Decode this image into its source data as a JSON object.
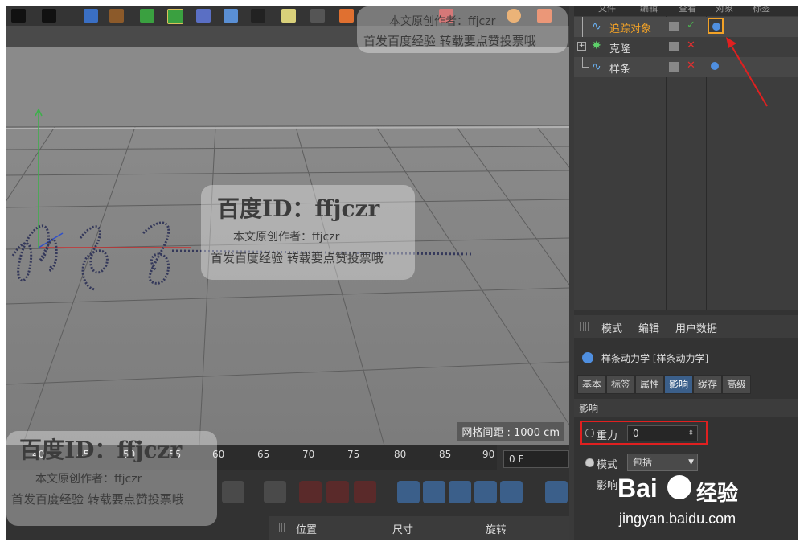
{
  "object_manager": {
    "menu": [
      "文件",
      "编辑",
      "查看",
      "对象",
      "标签"
    ],
    "objects": [
      {
        "name": "追踪对象",
        "highlighted": true
      },
      {
        "name": "克隆",
        "highlighted": false
      },
      {
        "name": "样条",
        "highlighted": false
      }
    ]
  },
  "attributes": {
    "menu": [
      "模式",
      "编辑",
      "用户数据"
    ],
    "title": "样条动力学 [样条动力学]",
    "tabs": [
      "基本",
      "标签",
      "属性",
      "影响",
      "缓存",
      "高级"
    ],
    "active_tab": "影响",
    "section": "影响",
    "gravity_label": "重力",
    "gravity_value": "0",
    "mode_label": "模式",
    "mode_value": "包括",
    "influence_label": "影响"
  },
  "viewport": {
    "grid_info": "网格间距 : 1000 cm"
  },
  "timeline": {
    "ticks": [
      "40",
      "45",
      "50",
      "55",
      "60",
      "65",
      "70",
      "75",
      "80",
      "85",
      "90"
    ],
    "current_frame": "0 F"
  },
  "coordinates": {
    "position": "位置",
    "size": "尺寸",
    "rotation": "旋转"
  },
  "watermark": {
    "title": "百度ID：ffjczr",
    "author": "本文原创作者：ffjczr",
    "note": "首发百度经验 转载要点赞投票哦"
  },
  "baidu_logo": {
    "brand": "Bai",
    "brand_suffix": "经验",
    "url": "jingyan.baidu.com"
  },
  "colors": {
    "accent_blue": "#3b5f8a",
    "highlight_orange": "#f2a227",
    "annotation_red": "#e02020"
  }
}
